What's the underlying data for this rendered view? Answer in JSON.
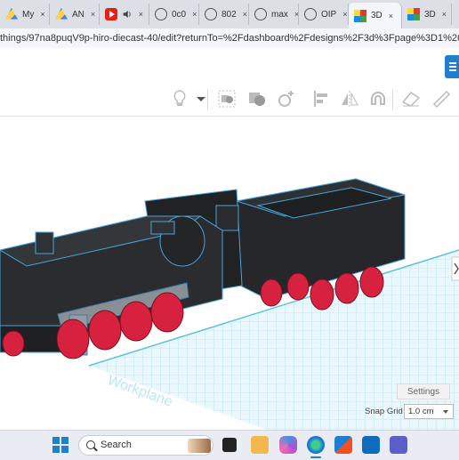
{
  "browser": {
    "tabs": [
      {
        "label": "My",
        "icon": "drive-icon",
        "active": false
      },
      {
        "label": "AN",
        "icon": "drive-icon",
        "active": false
      },
      {
        "label": "",
        "icon": "youtube-icon",
        "active": false
      },
      {
        "label": "0c0",
        "icon": "globe-icon",
        "active": false
      },
      {
        "label": "802",
        "icon": "globe-icon",
        "active": false
      },
      {
        "label": "max",
        "icon": "globe-icon",
        "active": false
      },
      {
        "label": "OIP",
        "icon": "globe-icon",
        "active": false
      },
      {
        "label": "3D",
        "icon": "tinkercad-icon",
        "active": true
      },
      {
        "label": "3D",
        "icon": "tinkercad-icon",
        "active": false
      }
    ],
    "close_glyph": "×",
    "url": "things/97na8puqV9p-hiro-diecast-40/edit?returnTo=%2Fdashboard%2Fdesigns%2F3d%3Fpage%3D1%26q%3Dhi..."
  },
  "workplane": {
    "label": "Workplane",
    "settings_label": "Settings",
    "snap_grid_label": "Snap Grid",
    "snap_grid_value": "1.0 cm"
  },
  "taskbar": {
    "search_label": "Search"
  },
  "colors": {
    "accent": "#1f7ecf",
    "workplane_grid": "#7fd0ee",
    "model_body": "#222426",
    "model_edge": "#4aa3d8",
    "wheels": "#d6223f",
    "side_rod": "#8a8f96"
  }
}
